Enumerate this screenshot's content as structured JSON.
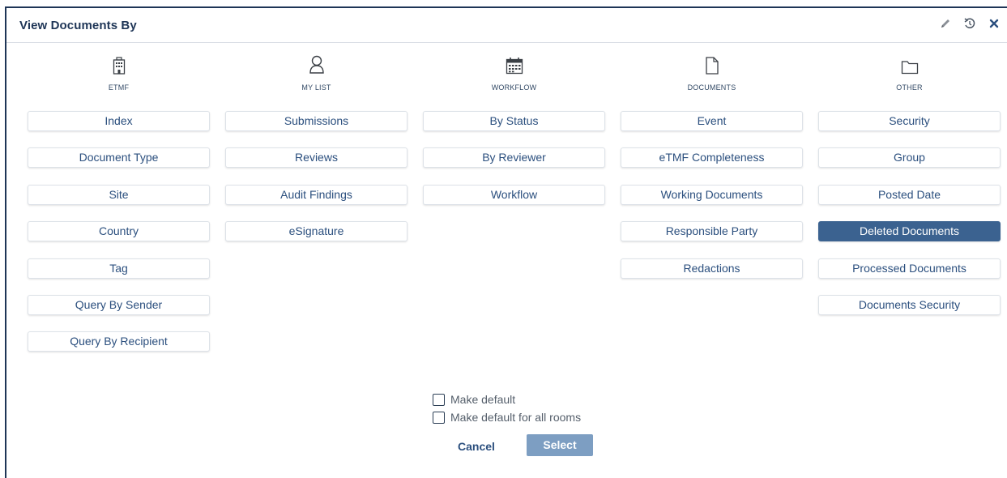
{
  "dialog": {
    "title": "View Documents By",
    "header_icons": [
      "pencil-icon",
      "reset-icon",
      "close-icon"
    ]
  },
  "categories": [
    {
      "label": "ETMF",
      "icon": "building-icon",
      "options": [
        "Index",
        "Document Type",
        "Site",
        "Country",
        "Tag",
        "Query By Sender",
        "Query By Recipient"
      ]
    },
    {
      "label": "MY LIST",
      "icon": "user-icon",
      "options": [
        "Submissions",
        "Reviews",
        "Audit Findings",
        "eSignature"
      ]
    },
    {
      "label": "WORKFLOW",
      "icon": "calendar-icon",
      "options": [
        "By Status",
        "By Reviewer",
        "Workflow"
      ]
    },
    {
      "label": "DOCUMENTS",
      "icon": "document-icon",
      "options": [
        "Event",
        "eTMF Completeness",
        "Working Documents",
        "Responsible Party",
        "Redactions"
      ]
    },
    {
      "label": "OTHER",
      "icon": "folder-icon",
      "options": [
        "Security",
        "Group",
        "Posted Date",
        "Deleted Documents",
        "Processed Documents",
        "Documents Security"
      ]
    }
  ],
  "selected_option": "Deleted Documents",
  "checkboxes": {
    "make_default": "Make default",
    "make_default_all_rooms": "Make default for all rooms"
  },
  "actions": {
    "cancel": "Cancel",
    "select": "Select"
  },
  "colors": {
    "selected_bg": "#3b6290",
    "select_button_bg": "#7d9ec2",
    "text_primary": "#2b4f7e",
    "border_dark": "#1e3556"
  }
}
